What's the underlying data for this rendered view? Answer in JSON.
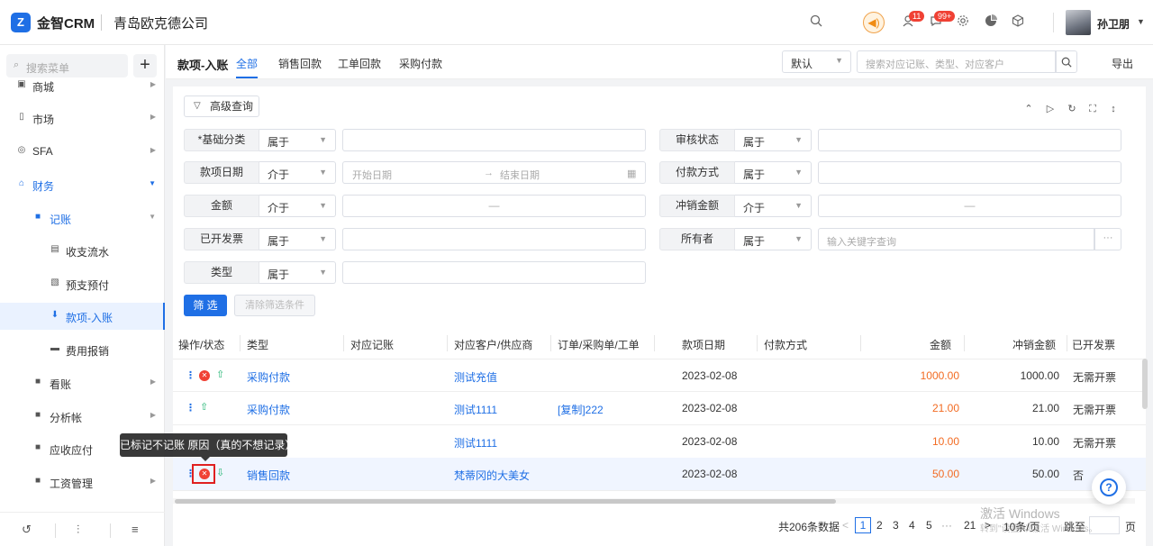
{
  "header": {
    "logo_mark": "Z",
    "logo": "金智CRM",
    "company": "青岛欧克德公司",
    "badge_bell": "11",
    "badge_msg": "99+",
    "user": "孙卫朋",
    "icons": [
      "search-icon",
      "megaphone-icon",
      "user-bell-icon",
      "message-icon",
      "settings-icon",
      "pie-chart-icon",
      "cube-icon"
    ]
  },
  "sidebar": {
    "search_placeholder": "搜索菜单",
    "plus": "+",
    "items": [
      {
        "label": "商城"
      },
      {
        "label": "市场"
      },
      {
        "label": "SFA"
      },
      {
        "label": "财务"
      },
      {
        "label": "记账"
      },
      {
        "label": "收支流水"
      },
      {
        "label": "预支预付"
      },
      {
        "label": "款项-入账"
      },
      {
        "label": "费用报销"
      },
      {
        "label": "看账"
      },
      {
        "label": "分析帐"
      },
      {
        "label": "应收应付"
      },
      {
        "label": "工资管理"
      }
    ]
  },
  "toolbar": {
    "title": "款项-入账",
    "tabs": [
      "全部",
      "销售回款",
      "工单回款",
      "采购付款"
    ],
    "sort": "默认",
    "search_placeholder": "搜索对应记账、类型、对应客户",
    "export": "导出"
  },
  "filter": {
    "advanced": "高级查询",
    "rows": [
      {
        "label": "*基础分类",
        "op": "属于"
      },
      {
        "label": "款项日期",
        "op": "介于",
        "start": "开始日期",
        "arrow": "→",
        "end": "结束日期"
      },
      {
        "label": "金额",
        "op": "介于",
        "dash": "—"
      },
      {
        "label": "已开发票",
        "op": "属于"
      },
      {
        "label": "类型",
        "op": "属于"
      },
      {
        "label": "审核状态",
        "op": "属于"
      },
      {
        "label": "付款方式",
        "op": "属于"
      },
      {
        "label": "冲销金额",
        "op": "介于",
        "dash": "—"
      },
      {
        "label": "所有者",
        "op": "属于",
        "placeholder": "输入关键字查询",
        "more": "···"
      }
    ],
    "submit": "筛 选",
    "clear": "清除筛选条件"
  },
  "table": {
    "headers": [
      "操作/状态",
      "类型",
      "对应记账",
      "对应客户/供应商",
      "订单/采购单/工单",
      "款项日期",
      "付款方式",
      "金额",
      "冲销金额",
      "已开发票"
    ],
    "rows": [
      {
        "type": "采购付款",
        "account": "",
        "customer": "测试充值",
        "order": "",
        "date": "2023-02-08",
        "pay": "",
        "amount": "1000.00",
        "offset": "1000.00",
        "invoice": "无需开票"
      },
      {
        "type": "采购付款",
        "account": "",
        "customer": "测试1111",
        "order": "[复制]222",
        "date": "2023-02-08",
        "pay": "",
        "amount": "21.00",
        "offset": "21.00",
        "invoice": "无需开票"
      },
      {
        "type": "",
        "account": "",
        "customer": "测试1111",
        "order": "",
        "date": "2023-02-08",
        "pay": "",
        "amount": "10.00",
        "offset": "10.00",
        "invoice": "无需开票"
      },
      {
        "type": "销售回款",
        "account": "",
        "customer": "梵蒂冈的大美女",
        "order": "",
        "date": "2023-02-08",
        "pay": "",
        "amount": "50.00",
        "offset": "50.00",
        "invoice": "否"
      }
    ],
    "tooltip": "已标记不记账 原因（真的不想记录）"
  },
  "pagination": {
    "total": "共206条数据",
    "prev": "<",
    "pages": [
      "1",
      "2",
      "3",
      "4",
      "5",
      "···",
      "21"
    ],
    "next": ">",
    "page_size": "10条/页",
    "jump": "跳至",
    "page_unit": "页"
  },
  "help": "?",
  "watermark": {
    "line1": "激活 Windows",
    "line2": "转到\"设置\"以激活 Windows。"
  },
  "colors": {
    "accent": "#1f6fe5",
    "amount": "#f26b22",
    "danger": "#f04134",
    "success": "#22b573"
  }
}
